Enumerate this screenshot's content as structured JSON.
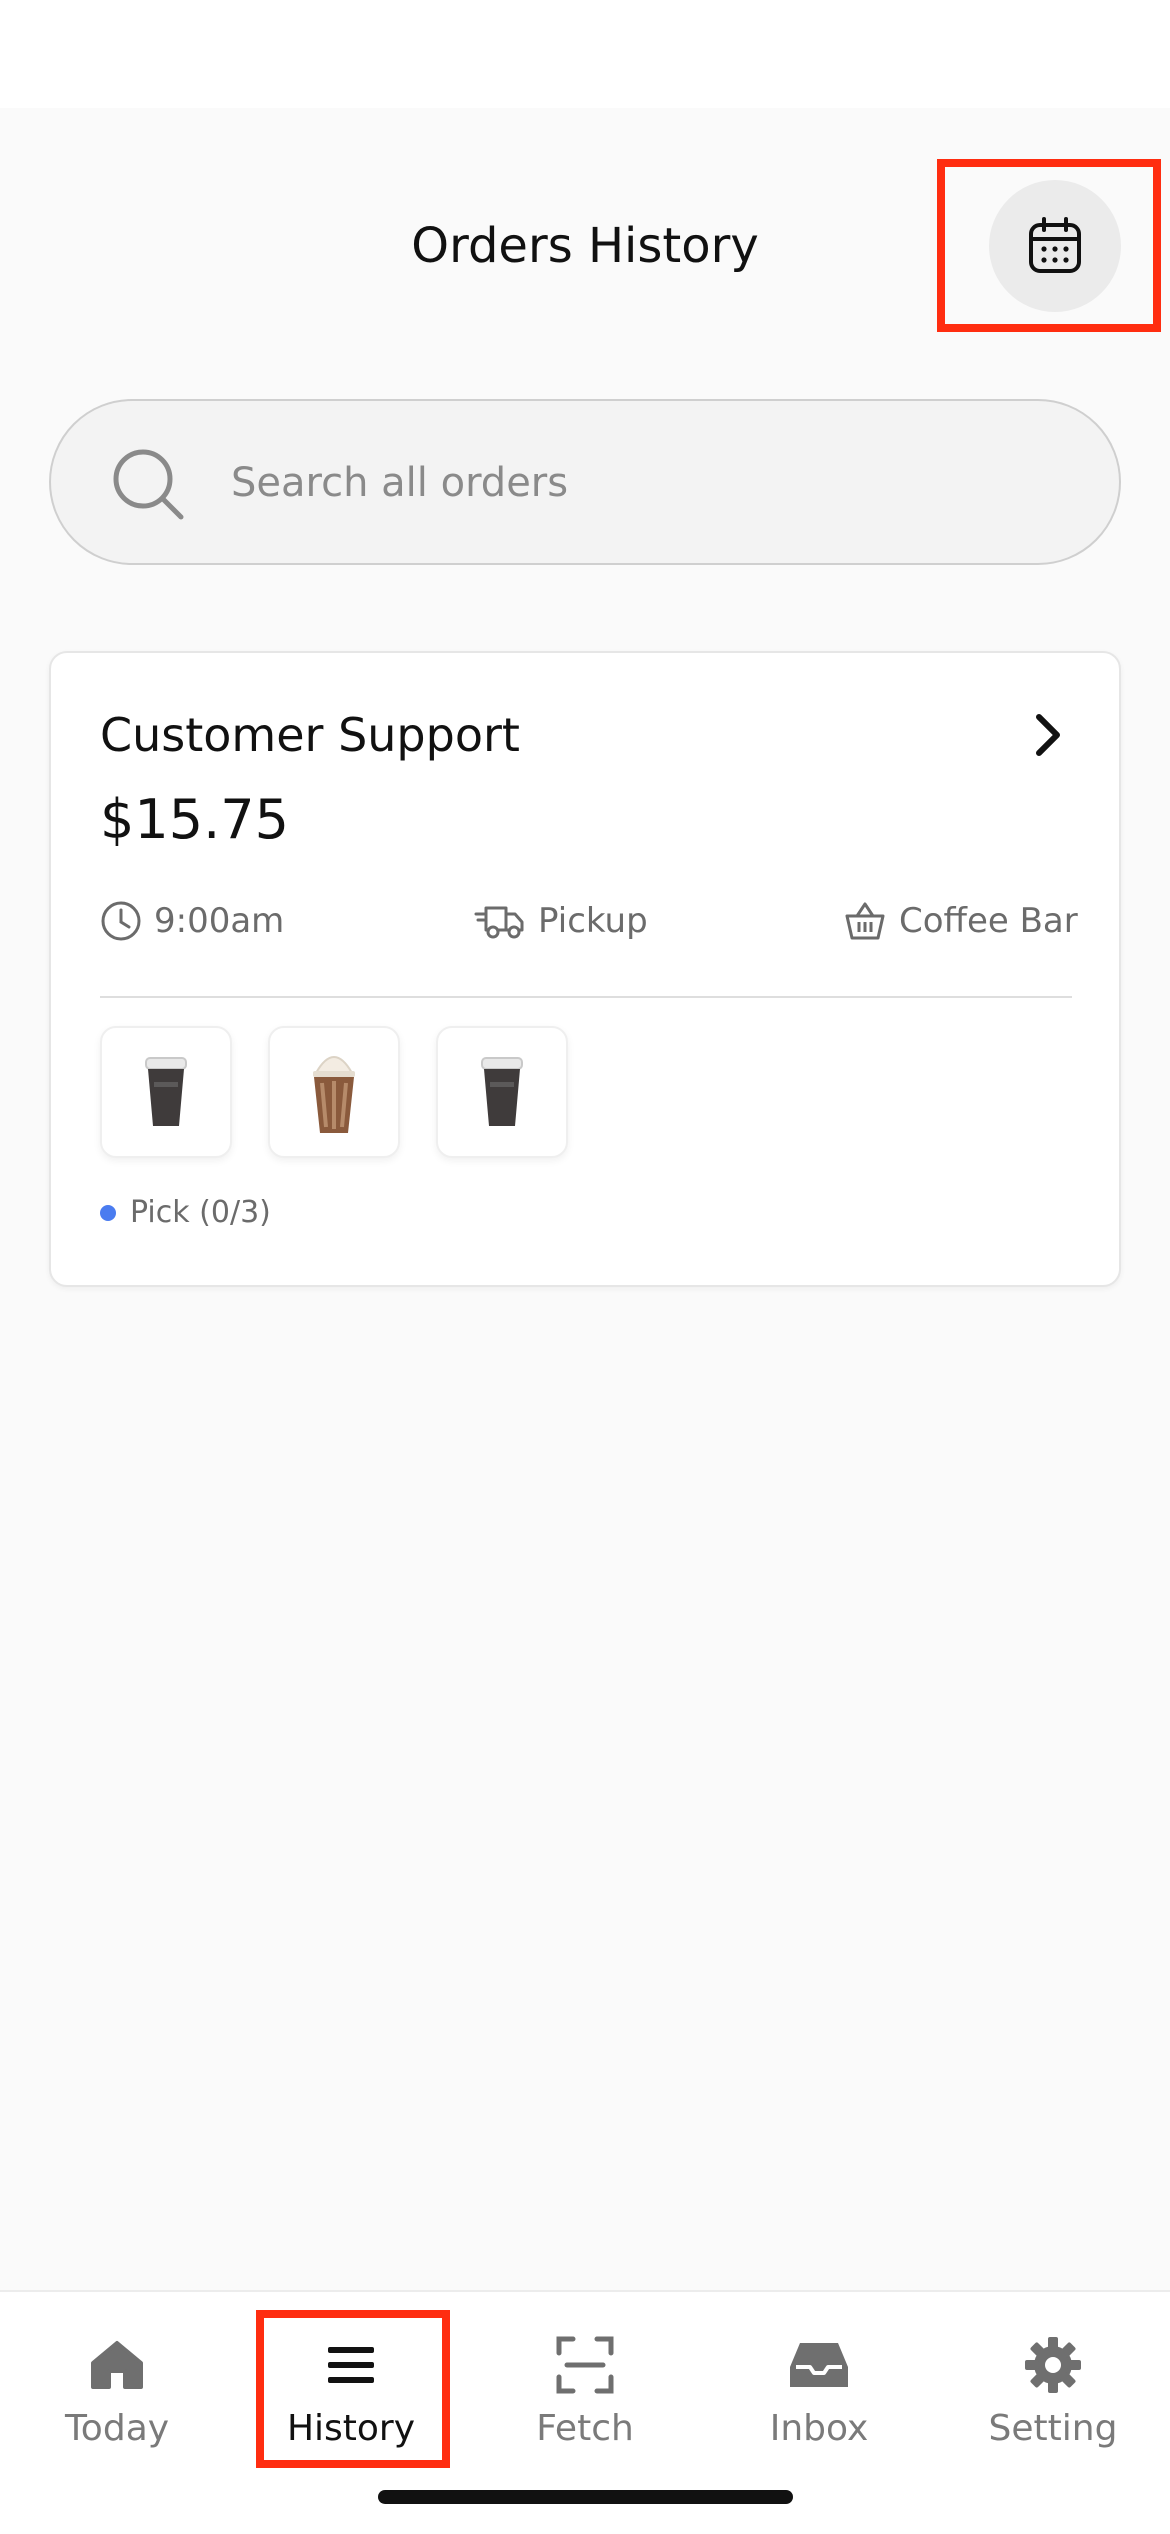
{
  "header": {
    "title": "Orders History"
  },
  "search": {
    "placeholder": "Search all orders"
  },
  "order": {
    "customer": "Customer Support",
    "total": "$15.75",
    "time": "9:00am",
    "fulfillment": "Pickup",
    "location": "Coffee Bar",
    "status": "Pick (0/3)",
    "status_color": "#4a7cf0",
    "products": [
      "coffee-cup-icon",
      "iced-mocha-icon",
      "coffee-cup-icon"
    ]
  },
  "nav": {
    "items": [
      {
        "label": "Today",
        "icon": "home-icon"
      },
      {
        "label": "History",
        "icon": "menu-icon",
        "active": true
      },
      {
        "label": "Fetch",
        "icon": "scan-icon"
      },
      {
        "label": "Inbox",
        "icon": "inbox-icon"
      },
      {
        "label": "Setting",
        "icon": "gear-icon"
      }
    ]
  },
  "colors": {
    "highlight": "#ff2d10",
    "accent_dot": "#4a7cf0"
  }
}
